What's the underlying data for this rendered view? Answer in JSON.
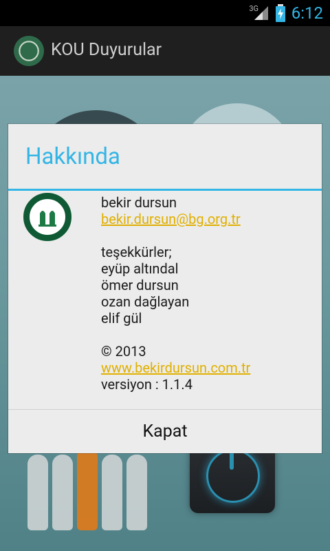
{
  "status": {
    "network": "3G",
    "time": "6:12"
  },
  "app": {
    "title": "KOU Duyurular"
  },
  "dialog": {
    "title": "Hakkında",
    "author_name": "bekir dursun",
    "author_email": "bekir.dursun@bg.org.tr",
    "thanks_header": "teşekkürler;",
    "thanks_names": [
      "eyüp altındal",
      "ömer dursun",
      "ozan dağlayan",
      "elif gül"
    ],
    "copyright": "© 2013",
    "website": "www.bekirdursun.com.tr",
    "version": "versiyon : 1.1.4",
    "close_label": "Kapat"
  },
  "colors": {
    "accent": "#33b5e5",
    "link": "#e0b000"
  }
}
